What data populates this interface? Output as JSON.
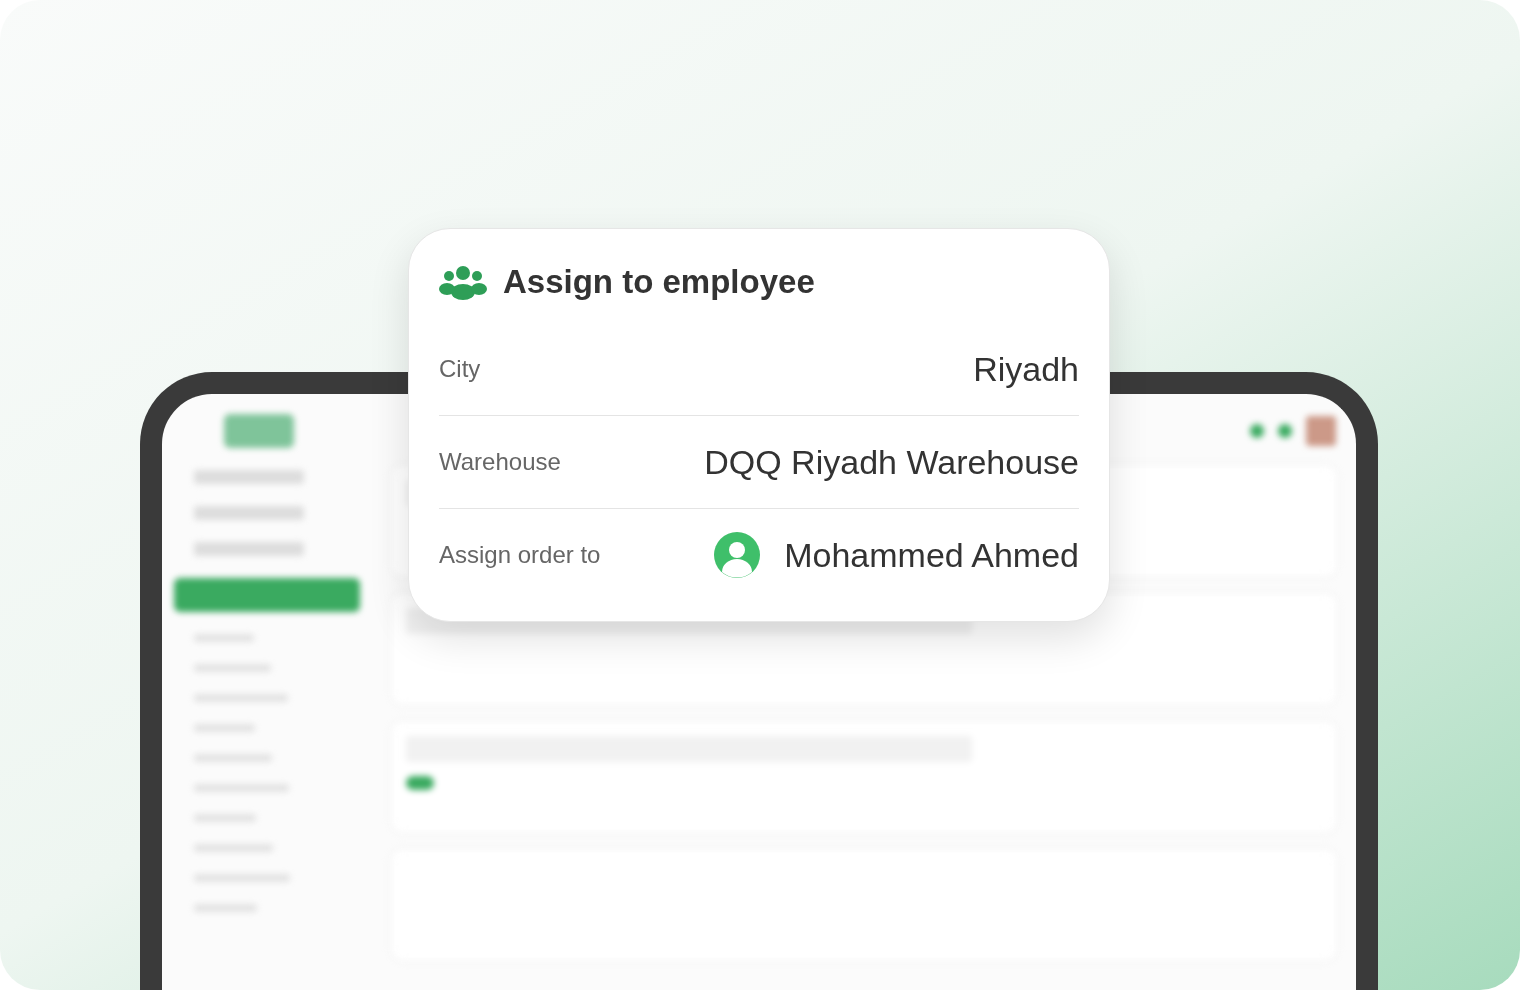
{
  "card": {
    "title": "Assign to employee",
    "rows": [
      {
        "kind": "text",
        "label": "City",
        "value": "Riyadh"
      },
      {
        "kind": "text",
        "label": "Warehouse",
        "value": "DQQ Riyadh Warehouse"
      },
      {
        "kind": "person",
        "label": "Assign order to",
        "value": "Mohammed Ahmed"
      }
    ]
  }
}
